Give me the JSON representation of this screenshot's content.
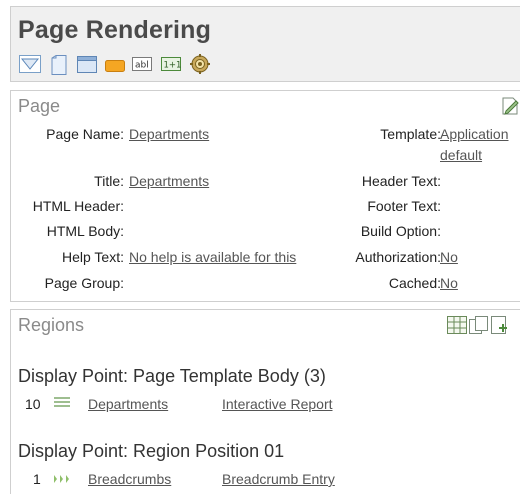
{
  "header": {
    "title": "Page Rendering",
    "toolbar_icons": [
      "triangle-down-icon",
      "page-icon",
      "region-icon",
      "button-icon",
      "text-item-icon",
      "computation-icon",
      "gear-icon"
    ]
  },
  "page_section": {
    "title": "Page",
    "edit_icon": "edit-icon",
    "left": [
      {
        "label": "Page Name:",
        "value": "Departments"
      },
      {
        "label": "Title:",
        "value": "Departments"
      },
      {
        "label": "HTML Header:",
        "value": ""
      },
      {
        "label": "HTML Body:",
        "value": ""
      },
      {
        "label": "Help Text:",
        "value": "No help is available for this"
      },
      {
        "label": "Page Group:",
        "value": ""
      }
    ],
    "right": [
      {
        "label": "Template:",
        "value": "Application",
        "value2": "default"
      },
      {
        "label": "Header Text:",
        "value": ""
      },
      {
        "label": "Footer Text:",
        "value": ""
      },
      {
        "label": "Build Option:",
        "value": ""
      },
      {
        "label": "Authorization:",
        "value": "No"
      },
      {
        "label": "Cached:",
        "value": "No"
      }
    ]
  },
  "regions_section": {
    "title": "Regions",
    "icons": [
      "grid-icon",
      "copy-icon",
      "add-icon"
    ],
    "display_points": [
      {
        "title": "Display Point: Page Template Body (3)",
        "regions": [
          {
            "seq": "10",
            "icon": "list-icon",
            "name": "Departments",
            "type": "Interactive Report"
          }
        ]
      },
      {
        "title": "Display Point: Region Position 01",
        "regions": [
          {
            "seq": "1",
            "icon": "breadcrumb-icon",
            "name": "Breadcrumbs",
            "type": "Breadcrumb Entry"
          }
        ]
      }
    ]
  }
}
